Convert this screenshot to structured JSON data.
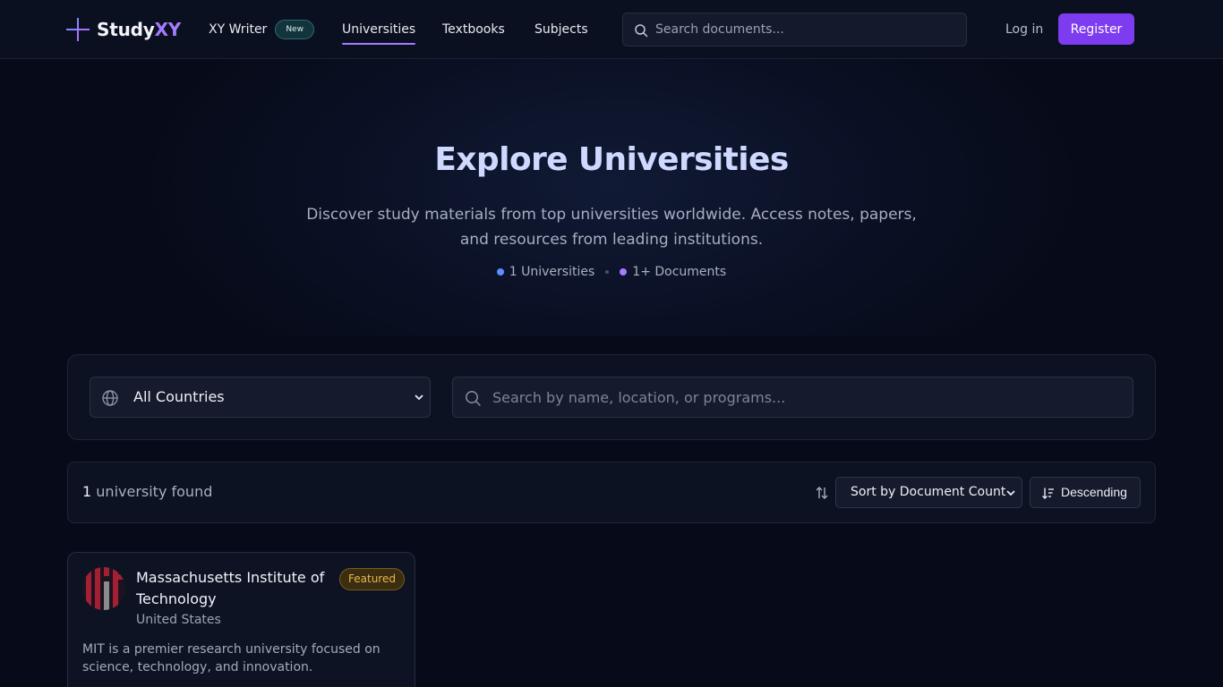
{
  "header": {
    "brand": "Study",
    "brand_accent": "XY",
    "nav": {
      "writer_label": "XY Writer",
      "writer_badge": "New",
      "universities": "Universities",
      "textbooks": "Textbooks",
      "subjects": "Subjects"
    },
    "search_placeholder": "Search documents...",
    "login": "Log in",
    "register": "Register"
  },
  "hero": {
    "title": "Explore Universities",
    "subtitle": "Discover study materials from top universities worldwide. Access notes, papers, and resources from leading institutions.",
    "stat_universities": "1 Universities",
    "stat_documents": "1+ Documents"
  },
  "filters": {
    "country_selected": "All Countries",
    "search_placeholder": "Search by name, location, or programs..."
  },
  "results": {
    "count": "1",
    "count_suffix": "university found",
    "sort_selected": "Sort by Document Count",
    "order": "Descending"
  },
  "universities": [
    {
      "name": "Massachusetts Institute of Technology",
      "country": "United States",
      "badge": "Featured",
      "description": "MIT is a premier research university focused on science, technology, and innovation."
    }
  ],
  "icons": {
    "search": "search-icon",
    "globe": "globe-icon",
    "sort": "sort-arrows-icon",
    "order": "sort-descending-icon",
    "chevron": "chevron-down-icon"
  },
  "colors": {
    "accent": "#7d3cf0",
    "accent_light": "#a47bff",
    "background": "#070b19",
    "featured": "#e8b84a"
  }
}
